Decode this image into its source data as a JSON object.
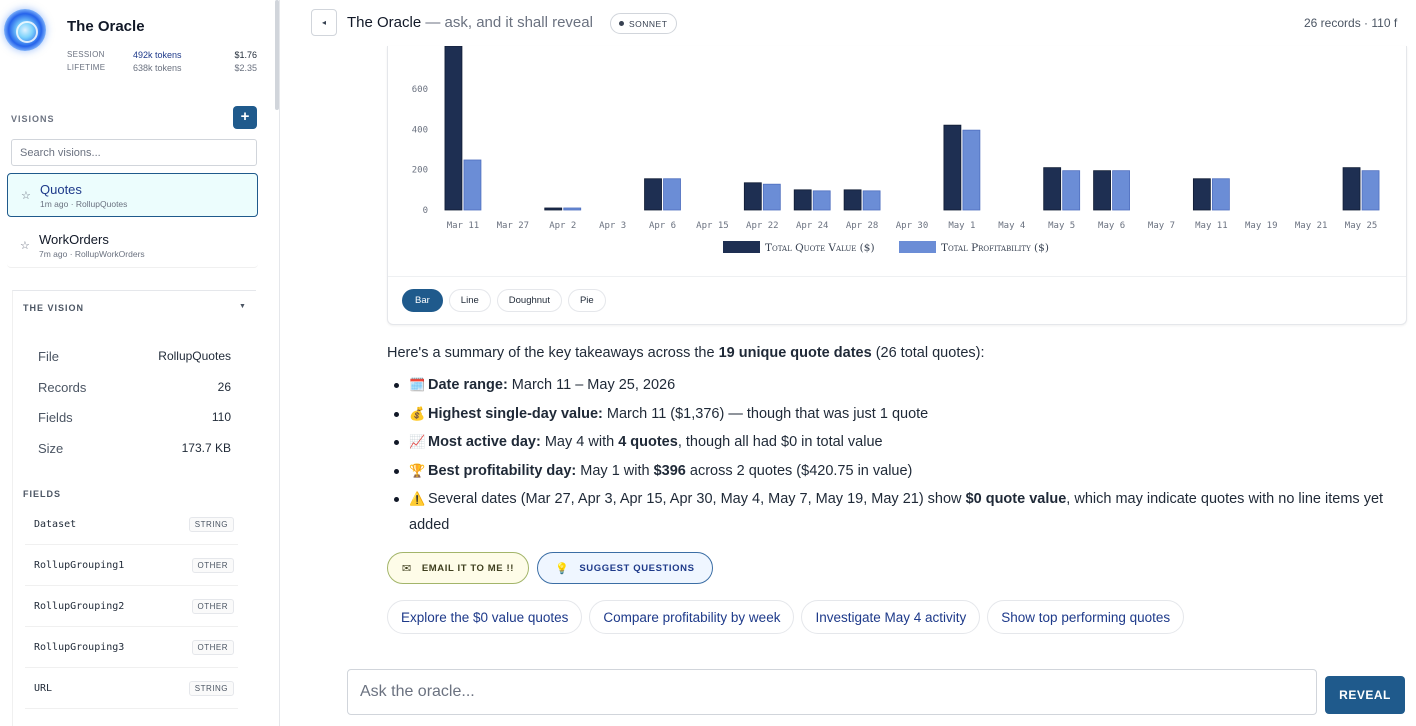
{
  "app": {
    "title": "The Oracle",
    "usage": [
      {
        "label": "SESSION",
        "tokens": "492k tokens",
        "cost": "$1.76"
      },
      {
        "label": "LIFETIME",
        "tokens": "638k tokens",
        "cost": "$2.35"
      }
    ]
  },
  "visions": {
    "label": "VISIONS",
    "add_label": "+",
    "search_placeholder": "Search visions...",
    "items": [
      {
        "name": "Quotes",
        "meta": "1m ago · RollupQuotes",
        "active": true
      },
      {
        "name": "WorkOrders",
        "meta": "7m ago · RollupWorkOrders",
        "active": false
      }
    ]
  },
  "vision_panel": {
    "title": "THE VISION",
    "stats": [
      {
        "key": "File",
        "value": "RollupQuotes"
      },
      {
        "key": "Records",
        "value": "26"
      },
      {
        "key": "Fields",
        "value": "110"
      },
      {
        "key": "Size",
        "value": "173.7 KB"
      }
    ],
    "fields_label": "FIELDS",
    "fields": [
      {
        "name": "Dataset",
        "type": "STRING"
      },
      {
        "name": "RollupGrouping1",
        "type": "OTHER"
      },
      {
        "name": "RollupGrouping2",
        "type": "OTHER"
      },
      {
        "name": "RollupGrouping3",
        "type": "OTHER"
      },
      {
        "name": "URL",
        "type": "STRING"
      }
    ]
  },
  "header": {
    "collapse_icon": "◂",
    "title": "The Oracle",
    "subtitle": "— ask, and it shall reveal",
    "model": "SONNET",
    "stats": "26 records · 110 f"
  },
  "chart_data": {
    "type": "bar",
    "categories": [
      "Mar 11",
      "Mar 27",
      "Apr 2",
      "Apr 3",
      "Apr 6",
      "Apr 15",
      "Apr 22",
      "Apr 24",
      "Apr 28",
      "Apr 30",
      "May 1",
      "May 4",
      "May 5",
      "May 6",
      "May 7",
      "May 11",
      "May 19",
      "May 21",
      "May 25"
    ],
    "series": [
      {
        "name": "Total Quote Value ($)",
        "color": "#1e2f52",
        "values": [
          1376,
          0,
          10,
          0,
          155,
          0,
          135,
          100,
          100,
          0,
          420.75,
          0,
          210,
          195,
          0,
          155,
          0,
          0,
          210
        ]
      },
      {
        "name": "Total Profitability ($)",
        "color": "#6b8dd6",
        "values": [
          248,
          0,
          10,
          0,
          155,
          0,
          128,
          95,
          95,
          0,
          396,
          0,
          195,
          195,
          0,
          155,
          0,
          0,
          195
        ]
      }
    ],
    "y_ticks": [
      "0",
      "200",
      "400",
      "600"
    ],
    "ylim": [
      0,
      800
    ],
    "legend": "bottom",
    "tabs": [
      "Bar",
      "Line",
      "Doughnut",
      "Pie"
    ],
    "active_tab": "Bar"
  },
  "summary": {
    "intro_pre": "Here's a summary of the key takeaways across the ",
    "intro_bold": "19 unique quote dates",
    "intro_post": " (26 total quotes):",
    "bullets": [
      {
        "icon": "🗓️",
        "bold": "Date range:",
        "text": " March 11 – May 25, 2026"
      },
      {
        "icon": "💰",
        "bold": "Highest single-day value:",
        "text": " March 11 ($1,376) — though that was just 1 quote"
      },
      {
        "icon": "📈",
        "bold": "Most active day:",
        "text": " May 4 with ",
        "bold2": "4 quotes",
        "text2": ", though all had $0 in total value"
      },
      {
        "icon": "🏆",
        "bold": "Best profitability day:",
        "text": " May 1 with ",
        "bold2": "$396",
        "text2": " across 2 quotes ($420.75 in value)"
      },
      {
        "icon": "⚠️",
        "bold": "",
        "text": "Several dates (Mar 27, Apr 3, Apr 15, Apr 30, May 4, May 7, May 19, May 21) show ",
        "bold2": "$0 quote value",
        "text2": ", which may indicate quotes with no line items yet added"
      }
    ]
  },
  "actions": {
    "email_label": "EMAIL IT TO ME !!",
    "suggest_label": "SUGGEST QUESTIONS"
  },
  "suggestions": [
    "Explore the $0 value quotes",
    "Compare profitability by week",
    "Investigate May 4 activity",
    "Show top performing quotes"
  ],
  "composer": {
    "placeholder": "Ask the oracle...",
    "submit_label": "REVEAL"
  }
}
